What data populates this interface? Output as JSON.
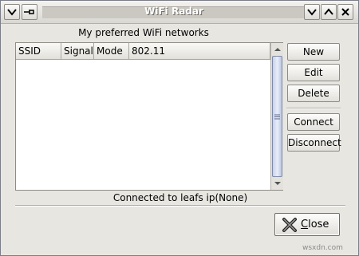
{
  "window": {
    "title": "WiFi Radar"
  },
  "heading": "My preferred WiFi networks",
  "table": {
    "columns": [
      "SSID",
      "Signal",
      "Mode",
      "802.11"
    ],
    "rows": []
  },
  "buttons": {
    "new": "New",
    "edit": "Edit",
    "delete": "Delete",
    "connect": "Connect",
    "disconnect": "Disconnect"
  },
  "status": "Connected to leafs ip(None)",
  "close": {
    "mnemonic": "C",
    "rest": "lose"
  },
  "watermark": "wsxdn.com"
}
